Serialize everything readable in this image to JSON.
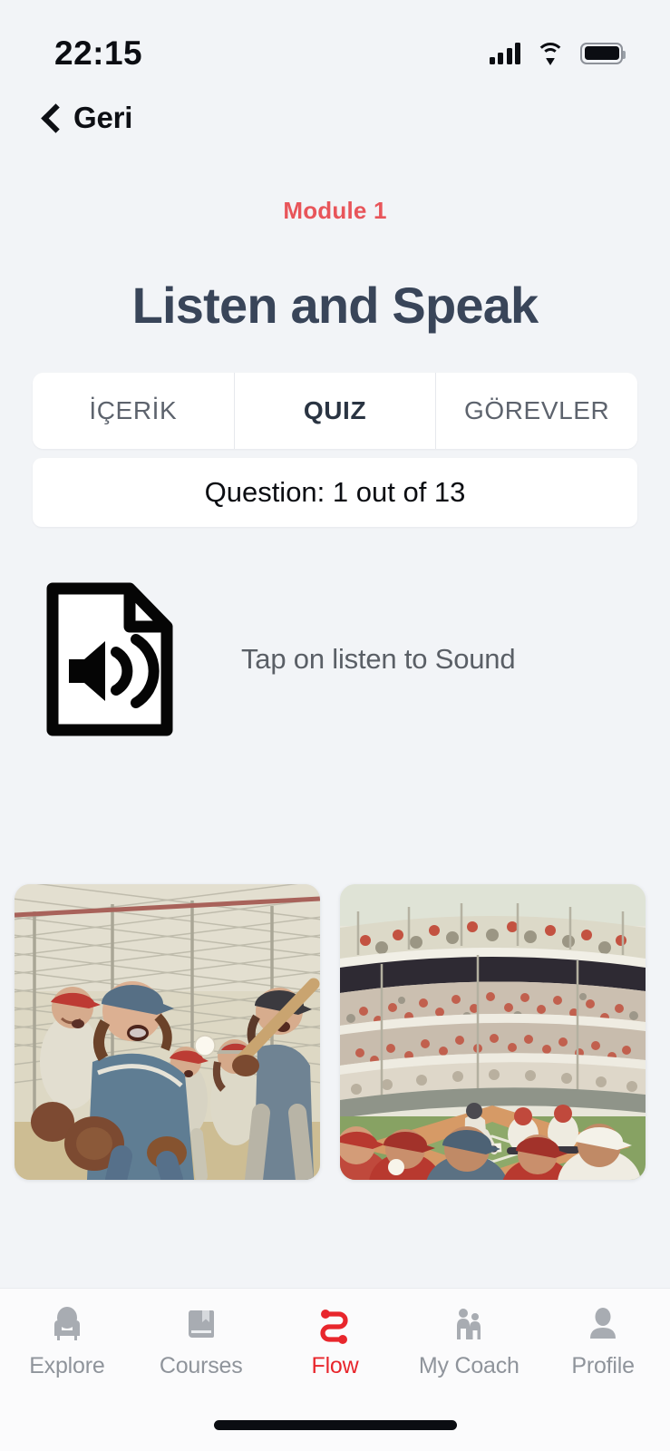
{
  "status_bar": {
    "time": "22:15",
    "cellular_icon": "cellular-signal-icon",
    "wifi_icon": "wifi-icon",
    "battery_icon": "battery-icon"
  },
  "nav": {
    "back_icon": "chevron-left-icon",
    "back_label": "Geri"
  },
  "header": {
    "module_label": "Module 1",
    "module_color": "#e8555a",
    "title": "Listen and Speak",
    "title_color": "#394559"
  },
  "tabs": {
    "items": [
      {
        "label": "İÇERİK",
        "active": false
      },
      {
        "label": "QUIZ",
        "active": true
      },
      {
        "label": "GÖREVLER",
        "active": false
      }
    ]
  },
  "question_bar": {
    "text": "Question: 1 out of 13",
    "current": 1,
    "total": 13
  },
  "audio": {
    "icon": "audio-file-speaker-icon",
    "prompt": "Tap on listen to Sound"
  },
  "answer_images": [
    {
      "alt": "youth-baseball-players-illustration",
      "name": "answer-option-1"
    },
    {
      "alt": "baseball-stadium-crowd-illustration",
      "name": "answer-option-2"
    }
  ],
  "bottom_nav": {
    "active_color": "#e8262c",
    "inactive_color": "#8f949b",
    "items": [
      {
        "label": "Explore",
        "icon": "armchair-icon",
        "active": false
      },
      {
        "label": "Courses",
        "icon": "book-icon",
        "active": false
      },
      {
        "label": "Flow",
        "icon": "flow-route-icon",
        "active": true
      },
      {
        "label": "My Coach",
        "icon": "two-people-icon",
        "active": false
      },
      {
        "label": "Profile",
        "icon": "person-icon",
        "active": false
      }
    ]
  },
  "home_indicator": "home-indicator-bar"
}
